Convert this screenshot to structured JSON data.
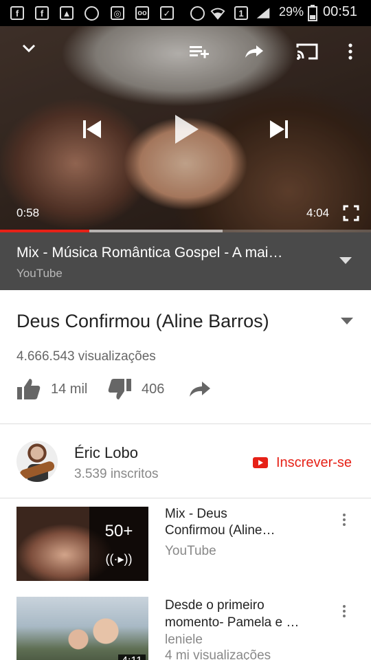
{
  "status_bar": {
    "battery": "29%",
    "time": "00:51",
    "sim_slot": "1"
  },
  "player": {
    "elapsed": "0:58",
    "duration": "4:04",
    "progress_fraction": 0.24,
    "buffered_fraction": 0.6,
    "accent_color": "#e62117"
  },
  "playlist": {
    "title": "Mix - Música Romântica Gospel - A mai…",
    "source": "YouTube"
  },
  "video": {
    "title": "Deus Confirmou (Aline Barros)",
    "views": "4.666.543 visualizações",
    "likes": "14 mil",
    "dislikes": "406"
  },
  "channel": {
    "name": "Éric Lobo",
    "subscribers": "3.539 inscritos",
    "subscribe_label": "Inscrever-se"
  },
  "up_next": [
    {
      "title_line1": "Mix - Deus",
      "title_line2": "Confirmou (Aline…",
      "subtitle": "YouTube",
      "count": "50+"
    },
    {
      "title_line1": "Desde o primeiro",
      "title_line2": "momento- Pamela e …",
      "subtitle": "leniele",
      "meta": "4 mi visualizações",
      "duration": "4:11"
    }
  ]
}
